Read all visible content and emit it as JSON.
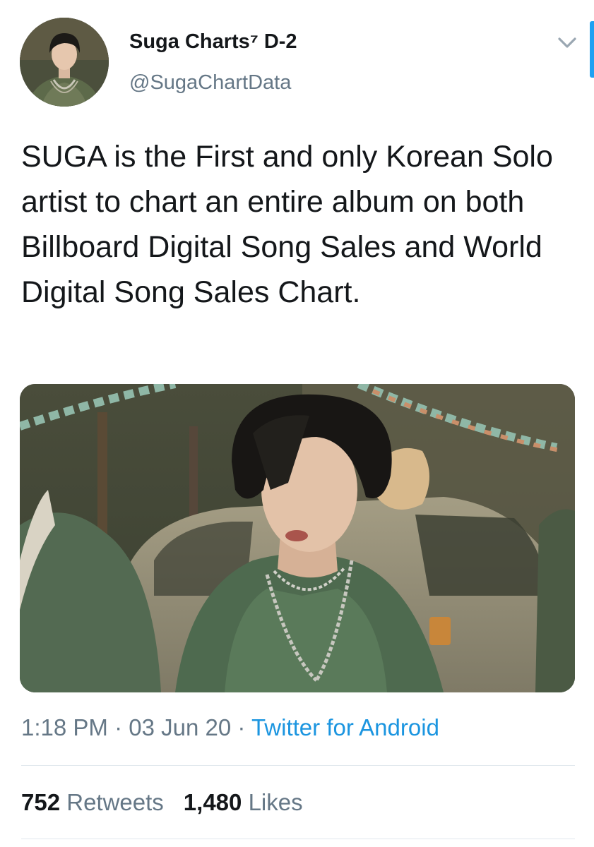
{
  "user": {
    "display_name": "Suga Charts⁷ D-2",
    "handle": "@SugaChartData",
    "avatar_icon": "profile-photo"
  },
  "tweet": {
    "text": "SUGA is the First and only Korean Solo artist to chart an entire album on both Billboard Digital Song Sales and World Digital Song Sales Chart.",
    "media_description_icon": "photo",
    "time": "1:18 PM",
    "separator": "·",
    "date": "03 Jun 20",
    "source": "Twitter for Android"
  },
  "stats": {
    "retweets_count": "752",
    "retweets_label": "Retweets",
    "likes_count": "1,480",
    "likes_label": "Likes"
  },
  "colors": {
    "text": "#14171a",
    "secondary": "#657786",
    "link": "#1b95e0",
    "divider": "#e1e8ed",
    "accent": "#1da1f2"
  }
}
